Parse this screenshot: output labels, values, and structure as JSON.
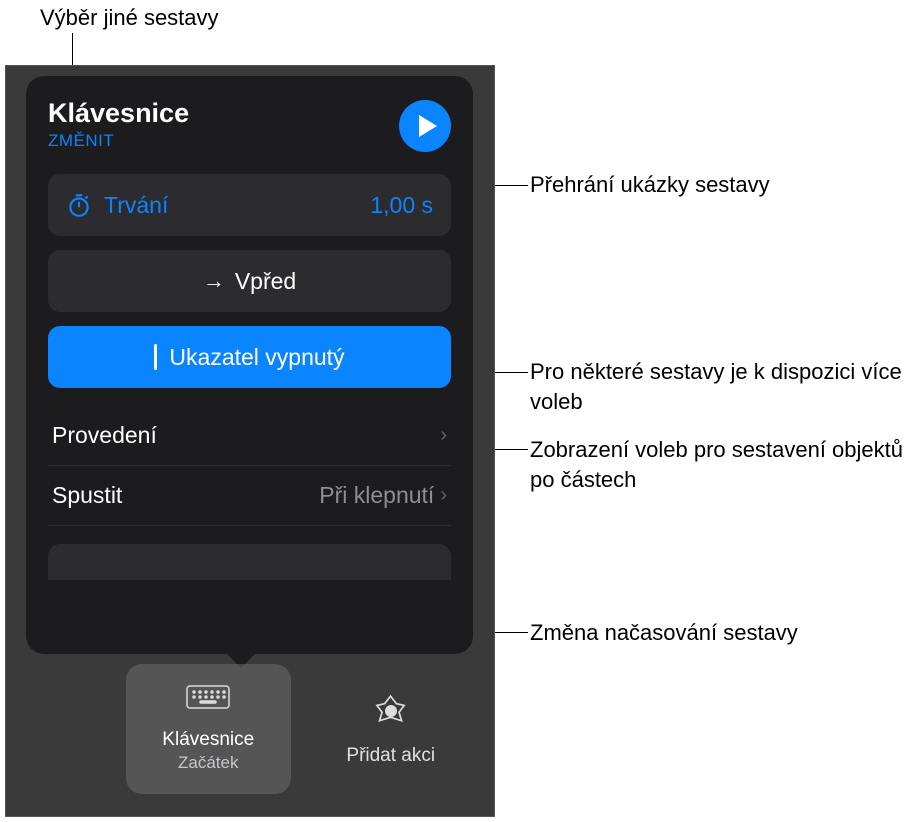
{
  "callouts": {
    "top": "Výběr jiné sestavy",
    "play": "Přehrání ukázky sestavy",
    "forward": "Pro některé sestavy je k dispozici více voleb",
    "pointer": "Zobrazení voleb pro sestavení objektů po částech",
    "start": "Změna načasování sestavy"
  },
  "popover": {
    "title": "Klávesnice",
    "change": "ZMĚNIT",
    "duration_label": "Trvání",
    "duration_value": "1,00 s",
    "forward": "Vpřed",
    "pointer": "Ukazatel vypnutý",
    "delivery_label": "Provedení",
    "start_label": "Spustit",
    "start_value": "Při klepnutí"
  },
  "bottom": {
    "tile1_title": "Klávesnice",
    "tile1_sub": "Začátek",
    "tile2_title": "Přidat akci"
  }
}
